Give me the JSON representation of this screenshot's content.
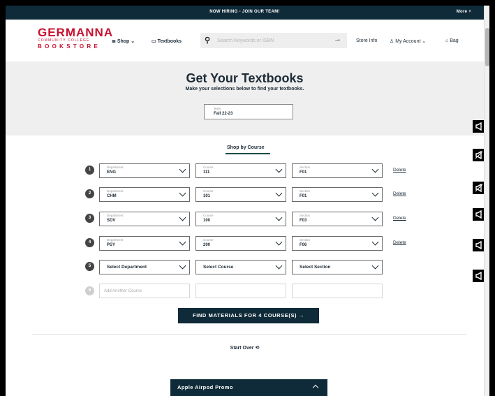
{
  "topbar": {
    "hiring": "NOW HIRING - JOIN OUR TEAM!",
    "more": "More  +"
  },
  "logo": {
    "line1": "GERMANNA",
    "line2": "COMMUNITY COLLEGE",
    "line3": "BOOKSTORE"
  },
  "nav": {
    "shop": "Shop",
    "textbooks": "Textbooks",
    "store_info": "Store Info",
    "my_account": "My Account",
    "bag": "Bag"
  },
  "search": {
    "placeholder": "Search Keywords or ISBN"
  },
  "hero": {
    "title": "Get Your Textbooks",
    "subtitle": "Make your selections below to find your textbooks.",
    "term_label": "Term",
    "term_value": "Fall 22-23"
  },
  "shop_by_course": "Shop by Course",
  "labels": {
    "department": "Department",
    "course": "Course",
    "section": "Section",
    "delete": "Delete"
  },
  "rows": [
    {
      "num": "1",
      "department": "ENG",
      "course": "111",
      "section": "F01"
    },
    {
      "num": "2",
      "department": "CHM",
      "course": "101",
      "section": "F01"
    },
    {
      "num": "3",
      "department": "SDV",
      "course": "100",
      "section": "F03"
    },
    {
      "num": "4",
      "department": "PSY",
      "course": "200",
      "section": "F06"
    }
  ],
  "row5": {
    "num": "5",
    "department": "Select Department",
    "course": "Select Course",
    "section": "Select Section"
  },
  "row6": {
    "num": "6",
    "placeholder": "Add Another Course"
  },
  "find_button": "FIND MATERIALS FOR 4 COURSE(S)  →",
  "start_over": "Start Over",
  "promo": "Apple Airpod Promo",
  "colors": {
    "navy": "#0f2a38",
    "brand_red": "#c8102e"
  },
  "icons": [
    "search-icon",
    "shop-menu-icon",
    "textbooks-icon",
    "account-icon",
    "bag-icon",
    "arrow-right-icon",
    "refresh-icon",
    "megaphone-icon"
  ]
}
